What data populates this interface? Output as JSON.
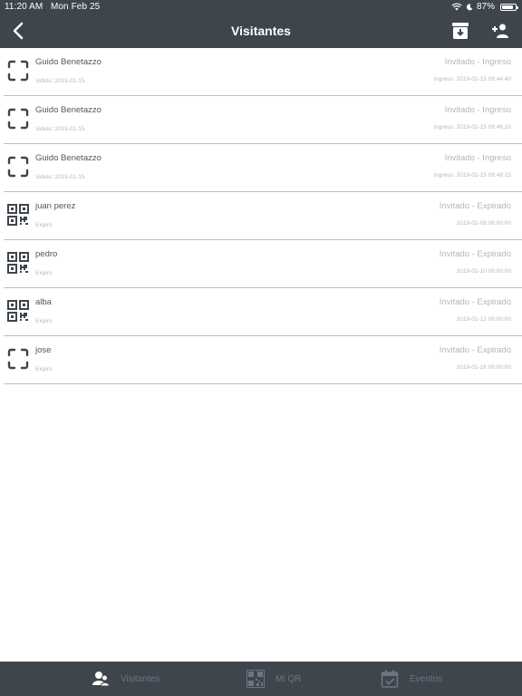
{
  "status_bar": {
    "time": "11:20 AM",
    "date": "Mon Feb 25",
    "battery": "87%",
    "battery_level": 0.87
  },
  "header": {
    "title": "Visitantes"
  },
  "visitors": [
    {
      "name": "Guido Benetazzo",
      "sub": "Valido: 2019-01-15",
      "status": "Invitado - Ingreso",
      "time": "Ingreso: 2019-01-15 09:44:40",
      "icon": "scan-frame-icon"
    },
    {
      "name": "Guido Benetazzo",
      "sub": "Valido: 2019-01-15",
      "status": "Invitado - Ingreso",
      "time": "Ingreso: 2019-01-15 09:46:20",
      "icon": "scan-frame-icon"
    },
    {
      "name": "Guido Benetazzo",
      "sub": "Valido: 2019-01-15",
      "status": "Invitado - Ingreso",
      "time": "Ingreso: 2019-01-15 09:48:15",
      "icon": "scan-frame-icon"
    },
    {
      "name": "juan perez",
      "sub": "Expiró",
      "status": "Invitado - Expirado",
      "time": "2019-01-08 06:00:00",
      "icon": "qr-code-icon"
    },
    {
      "name": "pedro",
      "sub": "Expiró",
      "status": "Invitado - Expirado",
      "time": "2019-01-10 06:00:00",
      "icon": "qr-code-icon"
    },
    {
      "name": "alba",
      "sub": "Expiró",
      "status": "Invitado - Expirado",
      "time": "2019-01-12 06:00:00",
      "icon": "qr-code-icon"
    },
    {
      "name": "jose",
      "sub": "Expiró",
      "status": "Invitado - Expirado",
      "time": "2019-01-16 06:00:00",
      "icon": "scan-frame-icon"
    }
  ],
  "tabs": [
    {
      "label": "Visitantes",
      "icon": "visitors-icon"
    },
    {
      "label": "Mi QR",
      "icon": "qr-code-icon"
    },
    {
      "label": "Eventos",
      "icon": "calendar-check-icon"
    }
  ],
  "colors": {
    "bar": "#3e454d",
    "text_muted": "#b5b5b5",
    "divider": "#bfbfbf",
    "tab_inactive": "#6c7680"
  }
}
